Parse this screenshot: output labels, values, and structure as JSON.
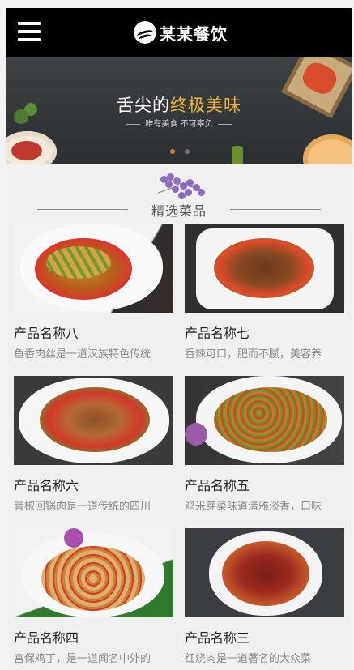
{
  "header": {
    "brand": "某某餐饮",
    "icons": [
      "menu-icon",
      "logo-icon"
    ]
  },
  "banner": {
    "title_prefix": "舌尖的",
    "title_accent": "终极美味",
    "subtitle": "唯有美食 不可辜负",
    "slide_count": 2,
    "active_slide": 1,
    "colors": {
      "accent": "#f0b43c",
      "active_dot": "#e07b33"
    }
  },
  "section": {
    "title": "精选菜品"
  },
  "products": [
    {
      "name": "产品名称八",
      "desc": "鱼香肉丝是一道汉族特色传统"
    },
    {
      "name": "产品名称七",
      "desc": "香辣可口，肥而不腻，美容养"
    },
    {
      "name": "产品名称六",
      "desc": "青椒回锅肉是一道传统的四川"
    },
    {
      "name": "产品名称五",
      "desc": "鸡米芽菜味道清雅淡香，口味"
    },
    {
      "name": "产品名称四",
      "desc": "宫保鸡丁，是一道闻名中外的"
    },
    {
      "name": "产品名称三",
      "desc": "红烧肉是一道著名的大众菜"
    }
  ]
}
